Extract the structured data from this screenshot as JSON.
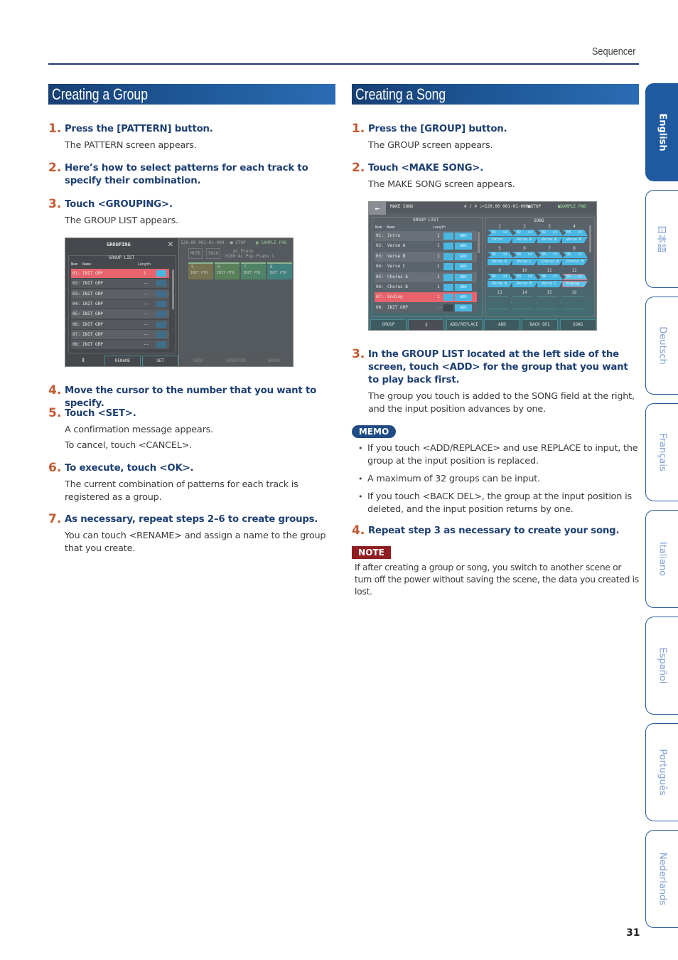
{
  "header": {
    "section": "Sequencer",
    "page_number": "31"
  },
  "group_section": {
    "title": "Creating a Group",
    "steps": [
      {
        "num": "1.",
        "title": "Press the [PATTERN] button.",
        "body": [
          "The PATTERN screen appears."
        ]
      },
      {
        "num": "2.",
        "title": "Here’s how to select patterns for each track to specify their combination.",
        "body": []
      },
      {
        "num": "3.",
        "title": "Touch <GROUPING>.",
        "body": [
          "The GROUP LIST appears."
        ]
      },
      {
        "num": "4.",
        "title": "Move the cursor to the number that you want to specify.",
        "body": []
      },
      {
        "num": "5.",
        "title": "Touch <SET>.",
        "body": [
          "A confirmation message appears.",
          "To cancel, touch <CANCEL>."
        ]
      },
      {
        "num": "6.",
        "title": "To execute, touch <OK>.",
        "body": [
          "The current combination of patterns for each track is registered as a group."
        ]
      },
      {
        "num": "7.",
        "title": "As necessary, repeat steps 2–6 to create groups.",
        "body": [
          "You can touch <RENAME> and assign a name to the group that you create."
        ]
      }
    ],
    "screen": {
      "title": "GROUPING",
      "list_title": "GROUP LIST",
      "columns": [
        "Num",
        "Name",
        "Length"
      ],
      "rows": [
        {
          "num": "01:",
          "name": "INIT GRP",
          "length": "1",
          "selected": true
        },
        {
          "num": "02:",
          "name": "INIT GRP",
          "length": "--"
        },
        {
          "num": "03:",
          "name": "INIT GRP",
          "length": "--"
        },
        {
          "num": "04:",
          "name": "INIT GRP",
          "length": "--"
        },
        {
          "num": "05:",
          "name": "INIT GRP",
          "length": "--"
        },
        {
          "num": "06:",
          "name": "INIT GRP",
          "length": "--"
        },
        {
          "num": "07:",
          "name": "INIT GRP",
          "length": "--"
        },
        {
          "num": "08:",
          "name": "INIT GRP",
          "length": "--"
        }
      ],
      "status": "120.00  001-01-000",
      "stop": "STOP",
      "sample_pad": "SAMPLE PAD",
      "mute": "MUTE",
      "solo": "SOLO",
      "tone_category": "Ac.Piano",
      "tone_name": "0189:Ac Pop Piano 1",
      "tracks": [
        {
          "num": "5",
          "pattern": "INIT PTN",
          "color": "#7d7a4e"
        },
        {
          "num": "6",
          "pattern": "INIT PTN",
          "color": "#5b8c5a"
        },
        {
          "num": "7",
          "pattern": "INIT PTN",
          "color": "#4e8e6a"
        },
        {
          "num": "8",
          "pattern": "INIT PTN",
          "color": "#3f8b86"
        }
      ],
      "buttons": [
        "RENAME",
        "SET",
        "UNDO",
        "GROUPING",
        "GROUP"
      ]
    }
  },
  "song_section": {
    "title": "Creating a Song",
    "steps": [
      {
        "num": "1.",
        "title": "Press the [GROUP] button.",
        "body": [
          "The GROUP screen appears."
        ]
      },
      {
        "num": "2.",
        "title": "Touch <MAKE SONG>.",
        "body": [
          "The MAKE SONG screen appears."
        ]
      },
      {
        "num": "3.",
        "title": "In the GROUP LIST located at the left side of the screen, touch <ADD> for the group that you want to play back first.",
        "body": [
          "The group you touch is added to the SONG field at the right, and the input position advances by one."
        ]
      },
      {
        "num": "4.",
        "title": "Repeat step 3 as necessary to create your song.",
        "body": []
      }
    ],
    "memo": {
      "label": "MEMO",
      "items": [
        "If you touch <ADD/REPLACE> and use REPLACE to input, the group at the input position is replaced.",
        "A maximum of 32 groups can be input.",
        "If you touch <BACK DEL>, the group at the input position is deleted, and the input position returns by one."
      ]
    },
    "note": {
      "label": "NOTE",
      "text": "If after creating a group or song, you switch to another scene or turn off the power without saving the scene, the data you created is lost."
    },
    "screen": {
      "title": "MAKE SONG",
      "status": "4 / 4  ♩=120.00  001-01-000",
      "stop": "STOP",
      "sample_pad": "SAMPLE PAD",
      "list_title": "GROUP LIST",
      "columns": [
        "Num",
        "Name",
        "Length"
      ],
      "add_label": "ADD",
      "rows": [
        {
          "num": "01:",
          "name": "Intro",
          "length": "1"
        },
        {
          "num": "02:",
          "name": "Verse A",
          "length": "1"
        },
        {
          "num": "03:",
          "name": "Verse B",
          "length": "1"
        },
        {
          "num": "04:",
          "name": "Verse C",
          "length": "1"
        },
        {
          "num": "05:",
          "name": "Chorus A",
          "length": "1"
        },
        {
          "num": "06:",
          "name": "Chorus B",
          "length": "1"
        },
        {
          "num": "07:",
          "name": "Ending",
          "length": "1",
          "selected": true
        },
        {
          "num": "08:",
          "name": "INIT GRP",
          "length": "--"
        }
      ],
      "song_title": "SONG",
      "song": [
        {
          "pos": "1",
          "group": "01",
          "rep": "x1",
          "name": "Intro"
        },
        {
          "pos": "2",
          "group": "02",
          "rep": "x1",
          "name": "Verse A"
        },
        {
          "pos": "3",
          "group": "02",
          "rep": "x1",
          "name": "Verse A"
        },
        {
          "pos": "4",
          "group": "03",
          "rep": "x1",
          "name": "Verse B"
        },
        {
          "pos": "5",
          "group": "02",
          "rep": "x1",
          "name": "Verse A"
        },
        {
          "pos": "6",
          "group": "04",
          "rep": "x1",
          "name": "Verse C"
        },
        {
          "pos": "7",
          "group": "05",
          "rep": "x1",
          "name": "Chorus A"
        },
        {
          "pos": "8",
          "group": "06",
          "rep": "x1",
          "name": "Chorus B"
        },
        {
          "pos": "9",
          "group": "02",
          "rep": "x1",
          "name": "Verse A"
        },
        {
          "pos": "10",
          "group": "03",
          "rep": "x1",
          "name": "Verse B"
        },
        {
          "pos": "11",
          "group": "04",
          "rep": "x1",
          "name": "Verse C"
        },
        {
          "pos": "12",
          "group": "07",
          "rep": "x1",
          "name": "Ending",
          "current": true
        },
        {
          "pos": "13"
        },
        {
          "pos": "14"
        },
        {
          "pos": "15"
        },
        {
          "pos": "16"
        }
      ],
      "buttons": [
        "GROUP",
        "↕",
        "ADD/REPLACE",
        "ADD",
        "BACK DEL",
        "SONG"
      ]
    }
  },
  "language_tabs": [
    {
      "label": "English",
      "active": true
    },
    {
      "label": "日本語"
    },
    {
      "label": "Deutsch"
    },
    {
      "label": "Français"
    },
    {
      "label": "Italiano"
    },
    {
      "label": "Español"
    },
    {
      "label": "Português"
    },
    {
      "label": "Nederlands"
    }
  ]
}
